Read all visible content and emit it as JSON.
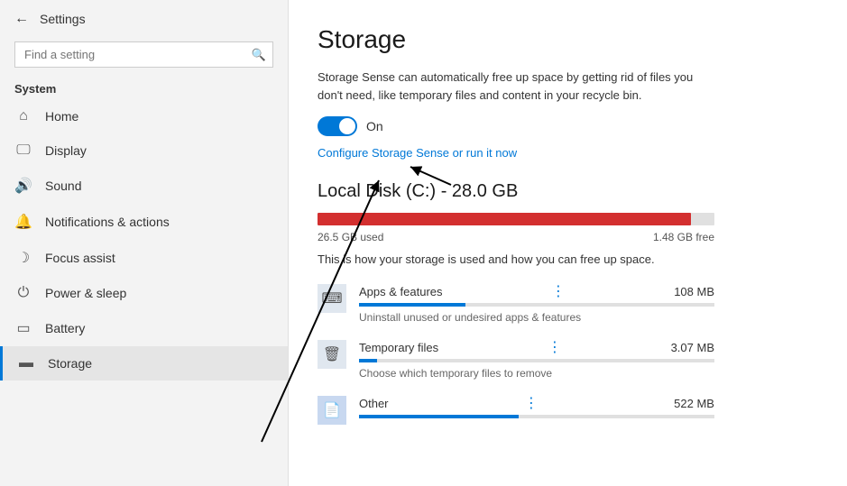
{
  "sidebar": {
    "header": {
      "back_label": "←",
      "title": "Settings"
    },
    "search": {
      "placeholder": "Find a setting"
    },
    "system_label": "System",
    "items": [
      {
        "id": "home",
        "label": "Home",
        "icon": "⌂"
      },
      {
        "id": "display",
        "label": "Display",
        "icon": "🖥"
      },
      {
        "id": "sound",
        "label": "Sound",
        "icon": "🔊"
      },
      {
        "id": "notifications",
        "label": "Notifications & actions",
        "icon": "🔔"
      },
      {
        "id": "focus",
        "label": "Focus assist",
        "icon": "🌙"
      },
      {
        "id": "power",
        "label": "Power & sleep",
        "icon": "⏻"
      },
      {
        "id": "battery",
        "label": "Battery",
        "icon": "🔋"
      },
      {
        "id": "storage",
        "label": "Storage",
        "icon": "💾",
        "active": true
      }
    ]
  },
  "main": {
    "title": "Storage",
    "description": "Storage Sense can automatically free up space by getting rid of files you don't need, like temporary files and content in your recycle bin.",
    "toggle_on": true,
    "toggle_label": "On",
    "configure_link": "Configure Storage Sense or run it now",
    "disk_title": "Local Disk (C:) - 28.0 GB",
    "disk_used": "26.5 GB used",
    "disk_free": "1.48 GB free",
    "disk_fill_pct": 94,
    "disk_desc": "This is how your storage is used and how you can free up space.",
    "storage_items": [
      {
        "name": "Apps & features",
        "size": "108 MB",
        "desc": "Uninstall unused or undesired apps & features",
        "fill_pct": 30,
        "icon": "⌨"
      },
      {
        "name": "Temporary files",
        "size": "3.07 MB",
        "desc": "Choose which temporary files to remove",
        "fill_pct": 5,
        "icon": "🗑"
      },
      {
        "name": "Other",
        "size": "522 MB",
        "desc": "",
        "fill_pct": 45,
        "icon": "📄"
      }
    ]
  }
}
